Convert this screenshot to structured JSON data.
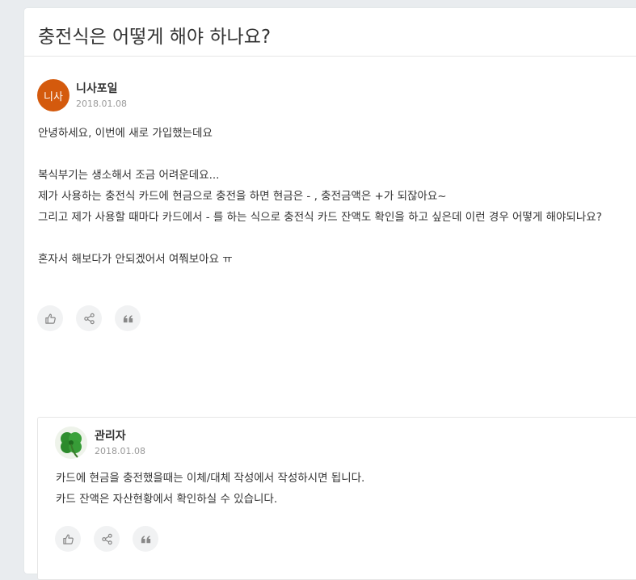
{
  "post": {
    "title": "충전식은 어떻게 해야 하나요?",
    "author": {
      "avatar_text": "니사",
      "name": "니사포일",
      "date": "2018.01.08",
      "avatar_color": "#d45a0d"
    },
    "body_lines": [
      "안녕하세요, 이번에 새로 가입했는데요",
      "",
      "복식부기는 생소해서 조금 어려운데요...",
      "제가 사용하는 충전식 카드에 현금으로 충전을 하면 현금은 - , 충전금액은 +가 되잖아요~",
      "그리고 제가 사용할 때마다 카드에서 - 를 하는 식으로 충전식 카드 잔액도 확인을 하고 싶은데 이런 경우 어떻게 해야되나요?",
      "",
      "혼자서 해보다가 안되겠어서 여쭤보아요 ㅠ"
    ],
    "actions": [
      "like-icon",
      "share-icon",
      "quote-icon"
    ]
  },
  "reply": {
    "author": {
      "name": "관리자",
      "date": "2018.01.08"
    },
    "body_lines": [
      "카드에 현금을 충전했을때는 이체/대체 작성에서 작성하시면 됩니다.",
      "카드 잔액은 자산현황에서 확인하실 수 있습니다."
    ],
    "actions": [
      "like-icon",
      "share-icon",
      "quote-icon"
    ]
  },
  "colors": {
    "background": "#e9ecef",
    "card": "#ffffff",
    "action_bg": "#f1f2f3",
    "icon": "#888888"
  }
}
